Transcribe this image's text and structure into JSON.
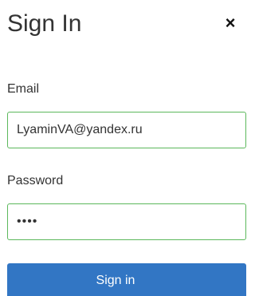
{
  "dialog": {
    "title": "Sign In",
    "close_icon": "×",
    "close_icon_name": "close-icon"
  },
  "form": {
    "email_label": "Email",
    "email_value": "LyaminVA@yandex.ru",
    "password_label": "Password",
    "password_value": "1234",
    "submit_label": "Sign in"
  },
  "colors": {
    "input_border_valid": "#5cb85c",
    "button_primary": "#3276c4",
    "text": "#333333"
  }
}
